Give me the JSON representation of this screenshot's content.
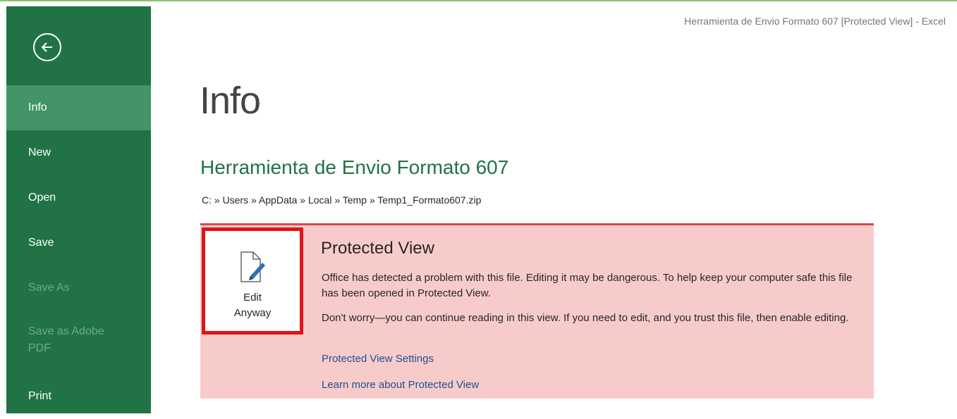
{
  "window": {
    "title": "Herramienta de Envio Formato 607  [Protected View] - Excel"
  },
  "sidebar": {
    "back_icon": "back-arrow-circle-icon",
    "items": [
      {
        "label": "Info",
        "state": "active"
      },
      {
        "label": "New",
        "state": "normal"
      },
      {
        "label": "Open",
        "state": "normal"
      },
      {
        "label": "Save",
        "state": "normal"
      },
      {
        "label": "Save As",
        "state": "disabled"
      },
      {
        "label_line1": "Save as Adobe",
        "label_line2": "PDF",
        "state": "disabled"
      },
      {
        "label": "Print",
        "state": "normal"
      }
    ]
  },
  "main": {
    "page_title": "Info",
    "document_title": "Herramienta de Envio Formato 607",
    "path": "C: » Users » AppData » Local » Temp » Temp1_Formato607.zip"
  },
  "protected_view": {
    "title": "Protected View",
    "message1": "Office has detected a problem with this file. Editing it may be dangerous. To help keep your computer safe this file has been opened in Protected View.",
    "message2": "Don't worry—you can continue reading in this view. If you need to edit, and you trust this file, then enable editing.",
    "link_settings": "Protected View Settings",
    "link_learn_more": "Learn more about Protected View",
    "edit_button": {
      "line1": "Edit",
      "line2": "Anyway",
      "icon": "document-pencil-icon"
    }
  },
  "colors": {
    "sidebar_bg": "#217346",
    "sidebar_active": "#439467",
    "banner_bg": "#f8cbcb",
    "banner_border": "#e2434a",
    "highlight_box": "#e01414",
    "link": "#1e4f91",
    "title_green": "#217346"
  }
}
